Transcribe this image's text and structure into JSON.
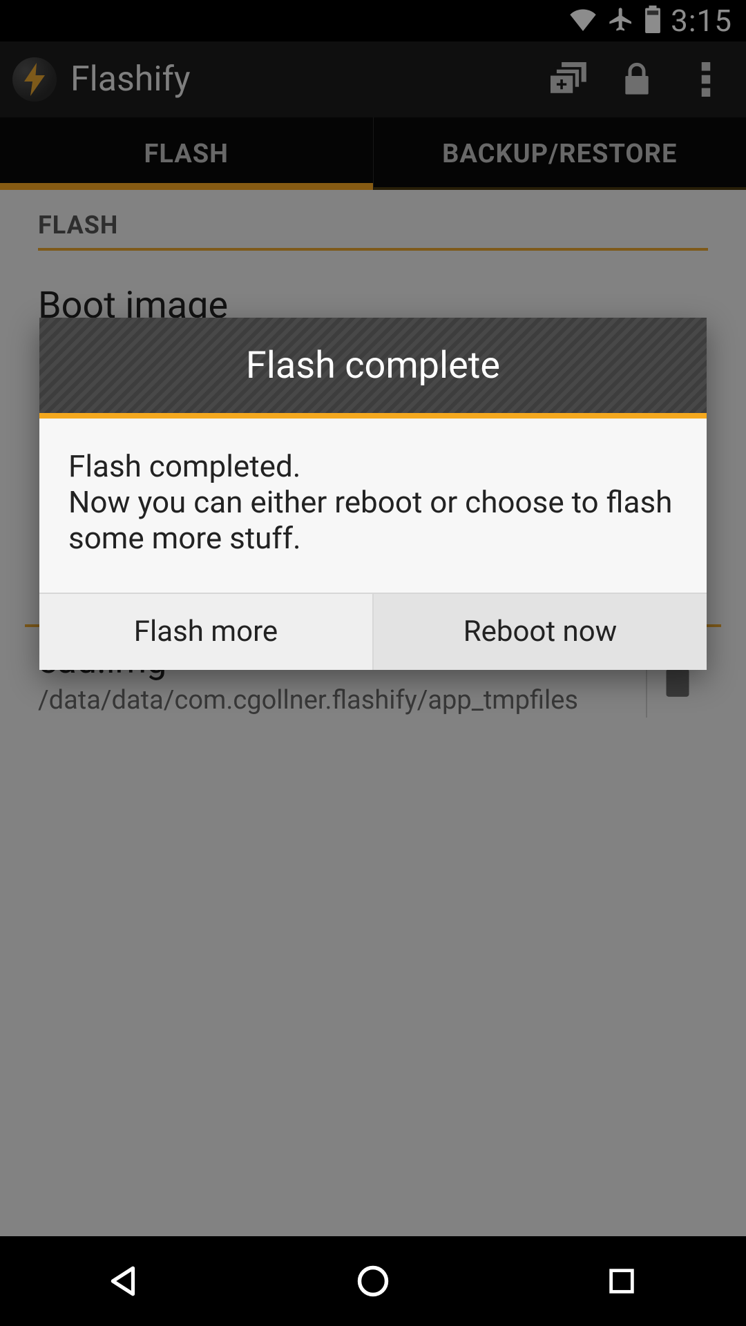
{
  "status": {
    "time": "3:15"
  },
  "app": {
    "title": "Flashify"
  },
  "tabs": {
    "flash": "FLASH",
    "backup": "BACKUP/RESTORE"
  },
  "section": {
    "heading": "FLASH",
    "item_title": "Boot image"
  },
  "queue": {
    "filename": "ead.img",
    "path": "/data/data/com.cgollner.flashify/app_tmpfiles"
  },
  "dialog": {
    "title": "Flash complete",
    "body": "Flash completed.\nNow you can either reboot or choose to flash some more stuff.",
    "btn_left": "Flash more",
    "btn_right": "Reboot now"
  }
}
